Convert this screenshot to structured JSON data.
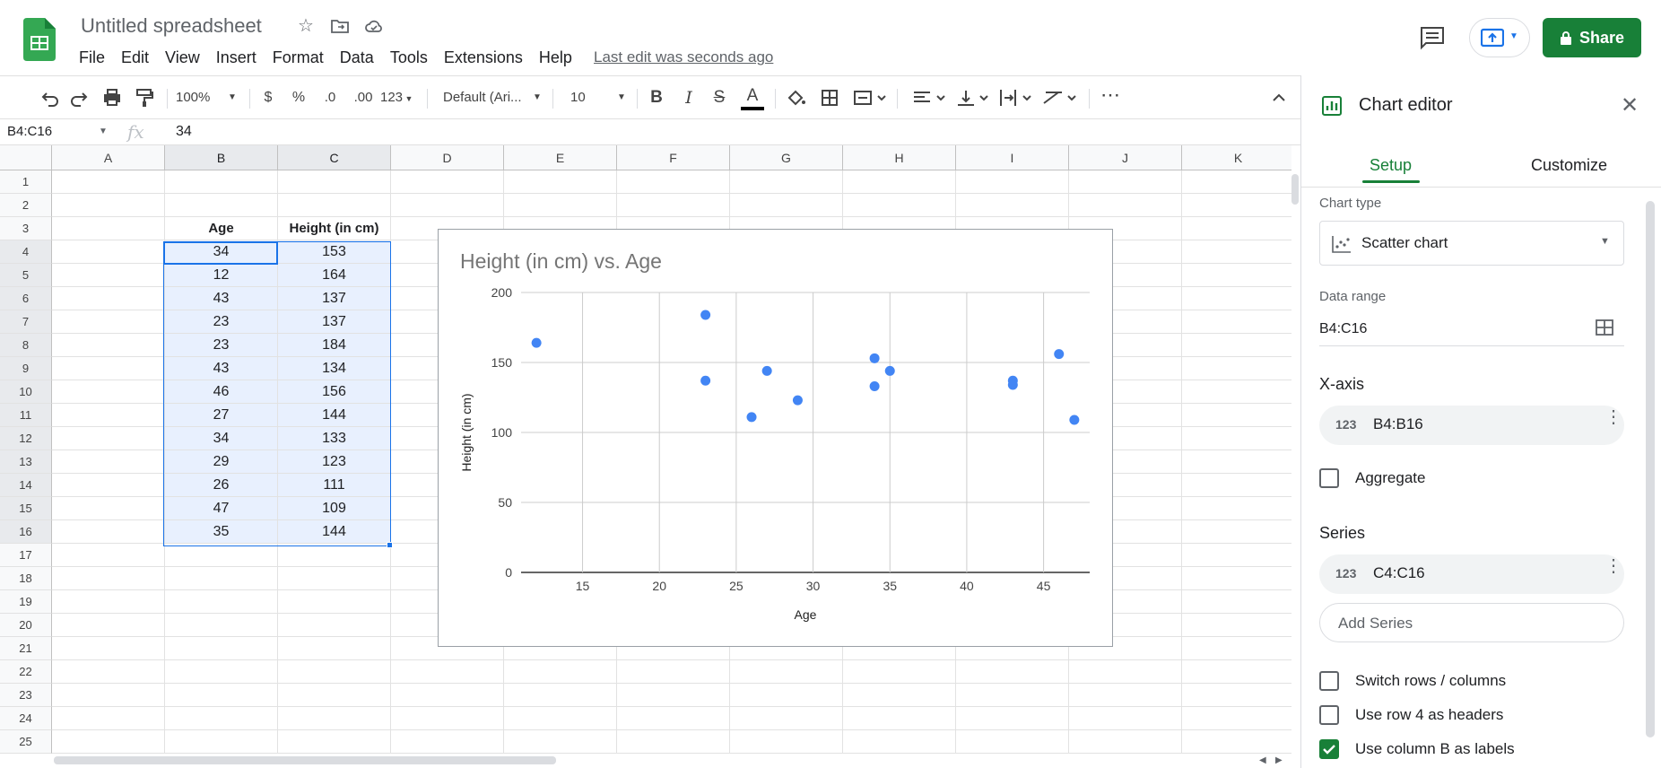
{
  "header": {
    "title": "Untitled spreadsheet",
    "menus": [
      "File",
      "Edit",
      "View",
      "Insert",
      "Format",
      "Data",
      "Tools",
      "Extensions",
      "Help"
    ],
    "last_edit": "Last edit was seconds ago",
    "share_label": "Share"
  },
  "toolbar": {
    "zoom": "100%",
    "currency": "$",
    "percent": "%",
    "dec_decrease": ".0",
    "dec_increase": ".00",
    "format_more": "123",
    "font": "Default (Ari...",
    "font_size": "10",
    "bold": "B",
    "italic": "I",
    "strike": "S",
    "text_color": "A",
    "more": "⋯"
  },
  "formula_bar": {
    "name_box": "B4:C16",
    "fx": "fx",
    "value": "34"
  },
  "grid": {
    "columns": [
      "A",
      "B",
      "C",
      "D",
      "E",
      "F",
      "G",
      "H",
      "I",
      "J",
      "K"
    ],
    "rows": [
      "1",
      "2",
      "3",
      "4",
      "5",
      "6",
      "7",
      "8",
      "9",
      "10",
      "11",
      "12",
      "13",
      "14",
      "15",
      "16",
      "17",
      "18",
      "19",
      "20",
      "21",
      "22",
      "23",
      "24",
      "25"
    ],
    "headers": {
      "age": "Age",
      "height": "Height (in cm)"
    },
    "data": [
      [
        "34",
        "153"
      ],
      [
        "12",
        "164"
      ],
      [
        "43",
        "137"
      ],
      [
        "23",
        "137"
      ],
      [
        "23",
        "184"
      ],
      [
        "43",
        "134"
      ],
      [
        "46",
        "156"
      ],
      [
        "27",
        "144"
      ],
      [
        "34",
        "133"
      ],
      [
        "29",
        "123"
      ],
      [
        "26",
        "111"
      ],
      [
        "47",
        "109"
      ],
      [
        "35",
        "144"
      ]
    ]
  },
  "chart_data": {
    "type": "scatter",
    "title": "Height (in cm) vs. Age",
    "xlabel": "Age",
    "ylabel": "Height (in cm)",
    "xlim": [
      11,
      48
    ],
    "ylim": [
      0,
      200
    ],
    "x_ticks": [
      15,
      20,
      25,
      30,
      35,
      40,
      45
    ],
    "y_ticks": [
      0,
      50,
      100,
      150,
      200
    ],
    "grid": true,
    "color": "#4285f4",
    "points": [
      [
        34,
        153
      ],
      [
        12,
        164
      ],
      [
        43,
        137
      ],
      [
        23,
        137
      ],
      [
        23,
        184
      ],
      [
        43,
        134
      ],
      [
        46,
        156
      ],
      [
        27,
        144
      ],
      [
        34,
        133
      ],
      [
        29,
        123
      ],
      [
        26,
        111
      ],
      [
        47,
        109
      ],
      [
        35,
        144
      ]
    ]
  },
  "editor": {
    "title": "Chart editor",
    "tabs": {
      "setup": "Setup",
      "customize": "Customize"
    },
    "chart_type_label": "Chart type",
    "chart_type": "Scatter chart",
    "data_range_label": "Data range",
    "data_range": "B4:C16",
    "x_axis_label": "X-axis",
    "x_axis_range": "B4:B16",
    "aggregate": "Aggregate",
    "series_label": "Series",
    "series_range": "C4:C16",
    "chip_icon": "123",
    "add_series": "Add Series",
    "switch_rows": "Switch rows / columns",
    "use_row_headers": "Use row 4 as headers",
    "use_col_labels": "Use column B as labels"
  },
  "colors": {
    "accent": "#188038",
    "selection": "#1a73e8",
    "point": "#4285f4"
  }
}
